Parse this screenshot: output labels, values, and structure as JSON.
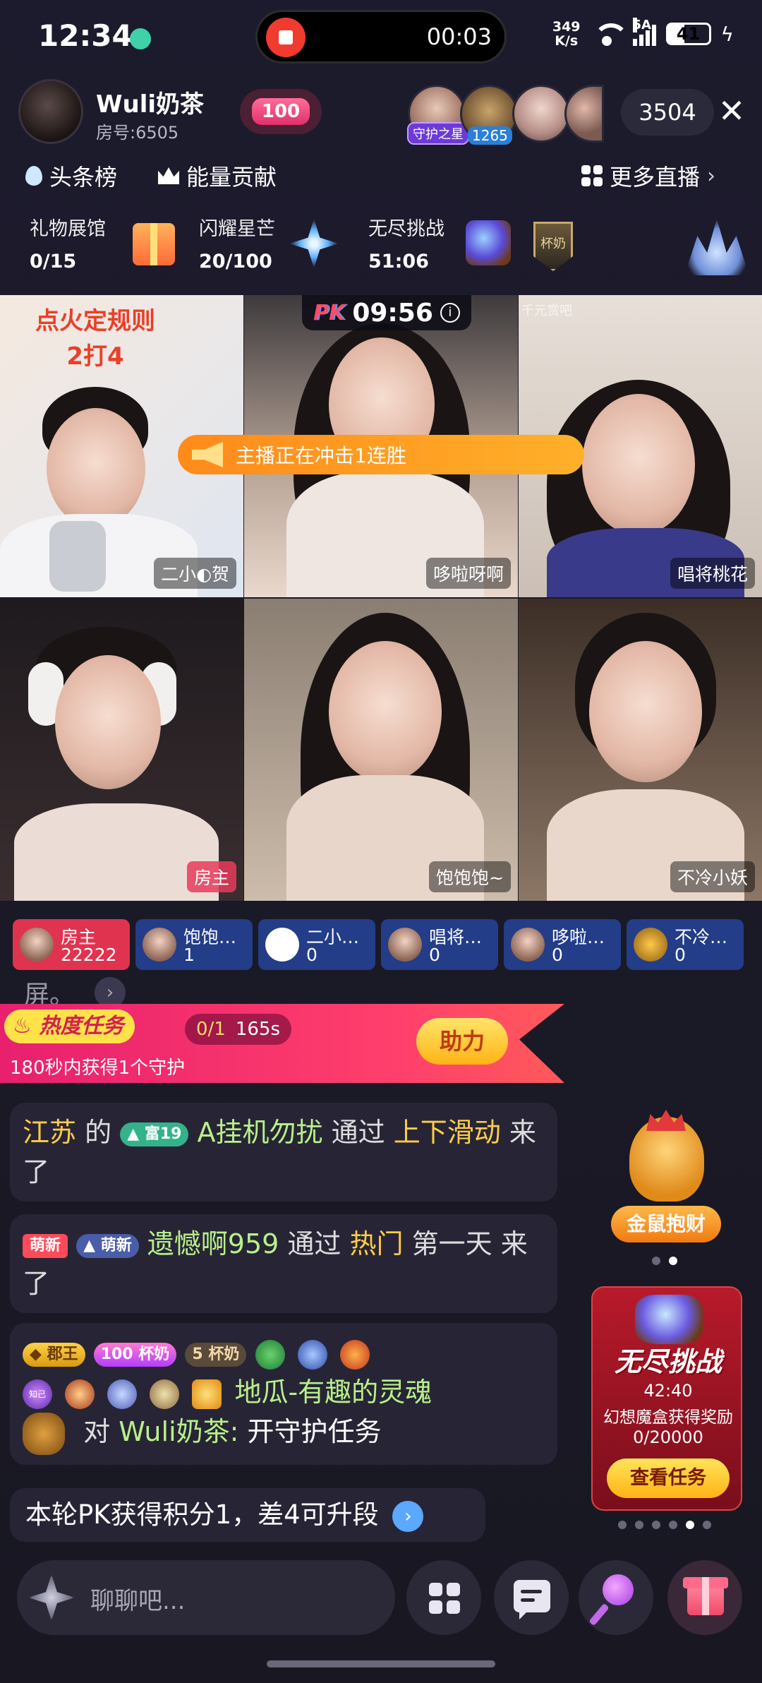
{
  "status_bar": {
    "time": "12:34",
    "record_time": "00:03",
    "net_speed_top": "349",
    "net_speed_unit": "K/s",
    "signal_label": "5A",
    "battery": "41"
  },
  "host": {
    "name": "Wuli奶茶",
    "room": "房号:6505",
    "fan_level": "100"
  },
  "viewers": {
    "guard_tag": "守护之星",
    "second_count": "1265",
    "online_count": "3504"
  },
  "tabs": {
    "headline": "头条榜",
    "energy": "能量贡献",
    "more_live": "更多直播"
  },
  "tasks": [
    {
      "title": "礼物展馆",
      "value": "0/15"
    },
    {
      "title": "闪耀星芒",
      "value": "20/100"
    },
    {
      "title": "无尽挑战",
      "value": "51:06"
    }
  ],
  "shield_text": "杯奶",
  "pk": {
    "logo": "PK",
    "timer": "09:56",
    "streak_text": "主播正在冲击1连胜",
    "rule_line1": "点火定规则",
    "rule_line2": "2打4",
    "top_right_label": "千元赏吧"
  },
  "cells": [
    {
      "name": "二小◐贺"
    },
    {
      "name": "哆啦呀啊"
    },
    {
      "name": "唱将桃花"
    },
    {
      "name": "房主"
    },
    {
      "name": "饱饱饱~"
    },
    {
      "name": "不冷小妖"
    }
  ],
  "scores": [
    {
      "name": "房主",
      "value": "22222"
    },
    {
      "name": "饱饱…",
      "value": "1"
    },
    {
      "name": "二小…",
      "value": "0"
    },
    {
      "name": "唱将…",
      "value": "0"
    },
    {
      "name": "哆啦…",
      "value": "0"
    },
    {
      "name": "不冷…",
      "value": "0"
    }
  ],
  "chat_fragment": "屏。",
  "heat_task": {
    "tag": "热度任务",
    "progress": "0/1",
    "seconds": "165s",
    "desc": "180秒内获得1个守护",
    "button": "助力"
  },
  "messages": {
    "m1": {
      "place": "江苏",
      "de": "的",
      "badge": "富19",
      "user": "A挂机勿扰",
      "via": "通过",
      "action": "上下滑动",
      "came": "来了"
    },
    "m2": {
      "tag1": "萌新",
      "tag2": "萌新",
      "user": "遗憾啊959",
      "via": "通过",
      "source": "热门",
      "rest": "第一天 来了"
    },
    "m3": {
      "b1": "郡王",
      "b2": "杯奶",
      "b2_level": "100",
      "b3": "杯奶",
      "b3_level": "5",
      "md_label": "知己",
      "user": "地瓜-有趣的灵魂",
      "to": "对",
      "target": "Wuli奶茶:",
      "content": "开守护任务"
    },
    "m4": {
      "text": "本轮PK获得积分1，差4可升段"
    }
  },
  "goldrat": {
    "label": "金鼠抱财"
  },
  "challenge": {
    "title": "无尽挑战",
    "time": "42:40",
    "desc": "幻想魔盒获得奖励",
    "progress": "0/20000",
    "button": "查看任务"
  },
  "bottom": {
    "placeholder": "聊聊吧..."
  }
}
